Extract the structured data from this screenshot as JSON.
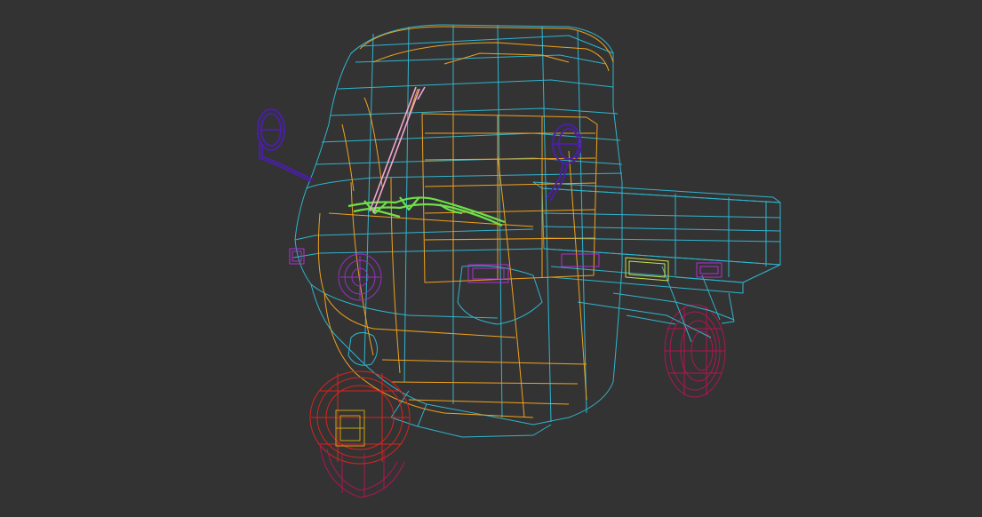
{
  "viewport": {
    "background": "#333333",
    "render_mode": "wireframe"
  },
  "model": {
    "parts": [
      {
        "name": "cab-body",
        "color": "#2fb5cf"
      },
      {
        "name": "cab-inner-frame",
        "color": "#f0a21c"
      },
      {
        "name": "cargo-bed",
        "color": "#2fb5cf"
      },
      {
        "name": "side-mirror-left",
        "color": "#4a1fa8"
      },
      {
        "name": "side-mirror-right",
        "color": "#4a1fa8"
      },
      {
        "name": "steering-handlebar",
        "color": "#6ee04a"
      },
      {
        "name": "wiper-antenna",
        "color": "#f4a6d0"
      },
      {
        "name": "headlight",
        "color": "#9b2fc4"
      },
      {
        "name": "indicator-lights",
        "color": "#b02fd0"
      },
      {
        "name": "front-wheel",
        "color": "#d8241e"
      },
      {
        "name": "front-wheel-hub",
        "color": "#c9a313"
      },
      {
        "name": "front-tire-lower",
        "color": "#b01552"
      },
      {
        "name": "rear-wheel",
        "color": "#b01552"
      },
      {
        "name": "license-plate",
        "color": "#c7e04a"
      }
    ]
  }
}
